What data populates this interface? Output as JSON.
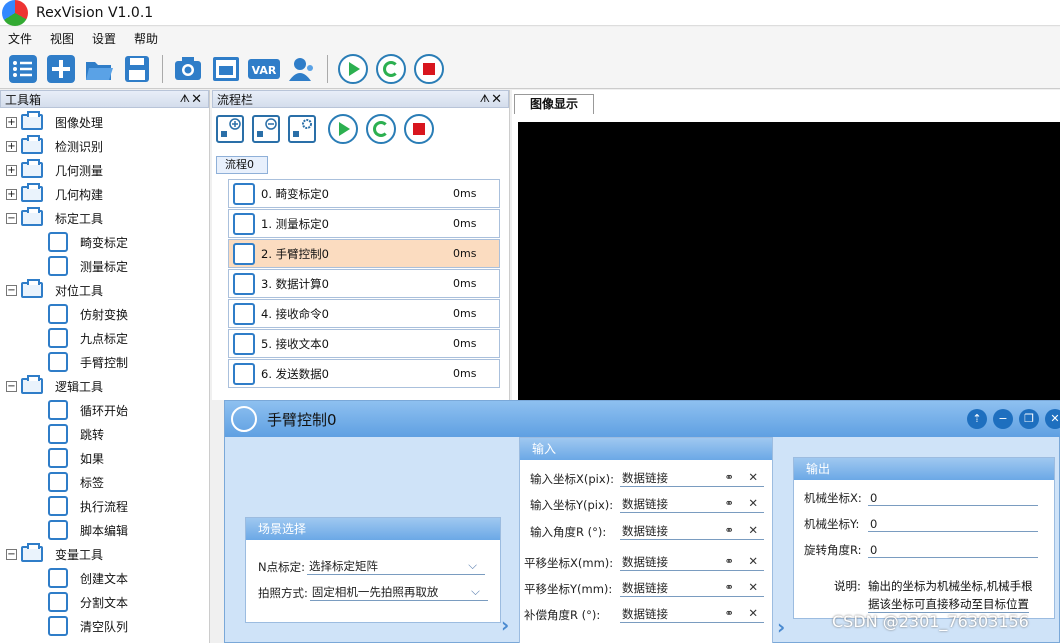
{
  "app": {
    "title": "RexVision V1.0.1"
  },
  "menu": [
    "文件",
    "视图",
    "设置",
    "帮助"
  ],
  "toolbar": {
    "icons": [
      "task-list-icon",
      "add-icon",
      "open-folder-icon",
      "save-icon",
      "camera-icon",
      "image-capture-icon",
      "variable-icon",
      "user-icon",
      "run-icon",
      "loop-run-icon",
      "stop-icon"
    ],
    "var_label": "VAR"
  },
  "toolbox": {
    "title": "工具箱",
    "pin": "ᗑ",
    "close": "✕",
    "items": [
      {
        "label": "图像处理",
        "level": 0,
        "expander": "+"
      },
      {
        "label": "检测识别",
        "level": 0,
        "expander": "+"
      },
      {
        "label": "几何测量",
        "level": 0,
        "expander": "+"
      },
      {
        "label": "几何构建",
        "level": 0,
        "expander": "+"
      },
      {
        "label": "标定工具",
        "level": 0,
        "expander": "−"
      },
      {
        "label": "畸变标定",
        "level": 1
      },
      {
        "label": "测量标定",
        "level": 1
      },
      {
        "label": "对位工具",
        "level": 0,
        "expander": "−"
      },
      {
        "label": "仿射变换",
        "level": 1
      },
      {
        "label": "九点标定",
        "level": 1
      },
      {
        "label": "手臂控制",
        "level": 1
      },
      {
        "label": "逻辑工具",
        "level": 0,
        "expander": "−"
      },
      {
        "label": "循环开始",
        "level": 1
      },
      {
        "label": "跳转",
        "level": 1
      },
      {
        "label": "如果",
        "level": 1
      },
      {
        "label": "标签",
        "level": 1
      },
      {
        "label": "执行流程",
        "level": 1
      },
      {
        "label": "脚本编辑",
        "level": 1
      },
      {
        "label": "变量工具",
        "level": 0,
        "expander": "−"
      },
      {
        "label": "创建文本",
        "level": 1
      },
      {
        "label": "分割文本",
        "level": 1
      },
      {
        "label": "清空队列",
        "level": 1
      }
    ]
  },
  "flow": {
    "title": "流程栏",
    "pin": "ᗑ",
    "close": "✕",
    "tab": "流程0",
    "rows": [
      {
        "label": "0. 畸变标定0",
        "time": "0ms"
      },
      {
        "label": "1. 测量标定0",
        "time": "0ms"
      },
      {
        "label": "2. 手臂控制0",
        "time": "0ms",
        "selected": true
      },
      {
        "label": "3. 数据计算0",
        "time": "0ms"
      },
      {
        "label": "4. 接收命令0",
        "time": "0ms"
      },
      {
        "label": "5. 接收文本0",
        "time": "0ms"
      },
      {
        "label": "6. 发送数据0",
        "time": "0ms"
      }
    ]
  },
  "image": {
    "tab": "图像显示"
  },
  "dialog": {
    "title": "手臂控制0",
    "buttons": [
      "⇡",
      "−",
      "❐",
      "✕"
    ],
    "scene": {
      "title": "场景选择",
      "fields": [
        {
          "label": "N点标定:",
          "value": "选择标定矩阵"
        },
        {
          "label": "拍照方式:",
          "value": "固定相机一先拍照再取放"
        }
      ]
    },
    "input": {
      "title": "输入",
      "fields": [
        {
          "label": "输入坐标X(pix):",
          "value": "数据链接"
        },
        {
          "label": "输入坐标Y(pix):",
          "value": "数据链接"
        },
        {
          "label": "输入角度R  (°):",
          "value": "数据链接"
        },
        {
          "label": "平移坐标X(mm):",
          "value": "数据链接"
        },
        {
          "label": "平移坐标Y(mm):",
          "value": "数据链接"
        },
        {
          "label": "补偿角度R  (°):",
          "value": "数据链接"
        }
      ]
    },
    "output": {
      "title": "输出",
      "fields": [
        {
          "label": "机械坐标X:",
          "value": "0"
        },
        {
          "label": "机械坐标Y:",
          "value": "0"
        },
        {
          "label": "旋转角度R:",
          "value": "0"
        }
      ],
      "note_label": "说明:",
      "note_line1": "输出的坐标为机械坐标,机械手根",
      "note_line2": "据该坐标可直接移动至目标位置"
    }
  },
  "watermark": "CSDN @2301_76303156"
}
